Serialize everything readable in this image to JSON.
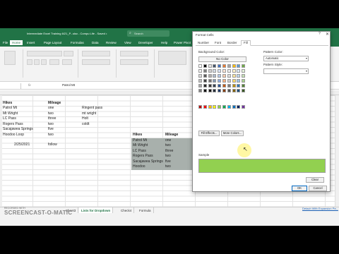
{
  "window": {
    "title": "Intermediate Excel Training 6/21_P...slsx - Compu Life - Saved •",
    "search_placeholder": "Search"
  },
  "menu": [
    "File",
    "Home",
    "Insert",
    "Page Layout",
    "Formulas",
    "Data",
    "Review",
    "View",
    "Developer",
    "Help",
    "Power Pivot"
  ],
  "formula_bar": {
    "name_box": "",
    "fx": "fx",
    "content": "Patrol Mt"
  },
  "cells": {
    "a_header": "Hikes",
    "mileage_header": "Mileage",
    "rows": [
      {
        "hike": "Patrol Mt",
        "mileage": "one",
        "extra": "Ringent pass"
      },
      {
        "hike": "Mt Wright",
        "mileage": "two",
        "extra": "mt wright"
      },
      {
        "hike": "LC Pass",
        "mileage": "three",
        "extra": "Holt"
      },
      {
        "hike": "Rogers Pass",
        "mileage": "two",
        "extra": "coldt"
      },
      {
        "hike": "Sacajawea Springs",
        "mileage": "five",
        "extra": ""
      },
      {
        "hike": "Hoodoo Loop",
        "mileage": "two",
        "extra": ""
      }
    ],
    "date": "2/25/2021",
    "fill_label": "follow"
  },
  "table": {
    "headers": [
      "Hikes",
      "Mileage"
    ],
    "rows": [
      [
        "Patrol Mt",
        "one"
      ],
      [
        "Mt Wright",
        "two"
      ],
      [
        "LC Pass",
        "three"
      ],
      [
        "Rogers Pass",
        "two"
      ],
      [
        "Sacajawea Springs",
        "five"
      ],
      [
        "Hoodoo",
        "two"
      ]
    ]
  },
  "sheet_tabs": [
    "Sheet3",
    "Lists for Dropdown",
    "Check4",
    "Formula"
  ],
  "active_tab": "Lists for Dropdown",
  "status_link": "Detach With Expansion Pa...",
  "watermark": {
    "line1": "RECORDED WITH",
    "line2": "SCREENCAST-O-MATIC"
  },
  "dialog": {
    "title": "Format Cells",
    "help": "?",
    "close": "✕",
    "tabs": [
      "Number",
      "Font",
      "Border",
      "Fill"
    ],
    "active_tab": "Fill",
    "background_color_label": "Background Color:",
    "no_color": "No Color",
    "fill_effects": "Fill Effects...",
    "more_colors": "More Colors...",
    "pattern_color_label": "Pattern Color:",
    "pattern_color_value": "Automatic",
    "pattern_style_label": "Pattern Style:",
    "pattern_style_value": "",
    "sample_label": "Sample",
    "sample_color": "#92d050",
    "clear": "Clear",
    "ok": "OK",
    "cancel": "Cancel"
  },
  "theme": {
    "accent": "#217346",
    "table_fill": "#a8b0ac"
  }
}
